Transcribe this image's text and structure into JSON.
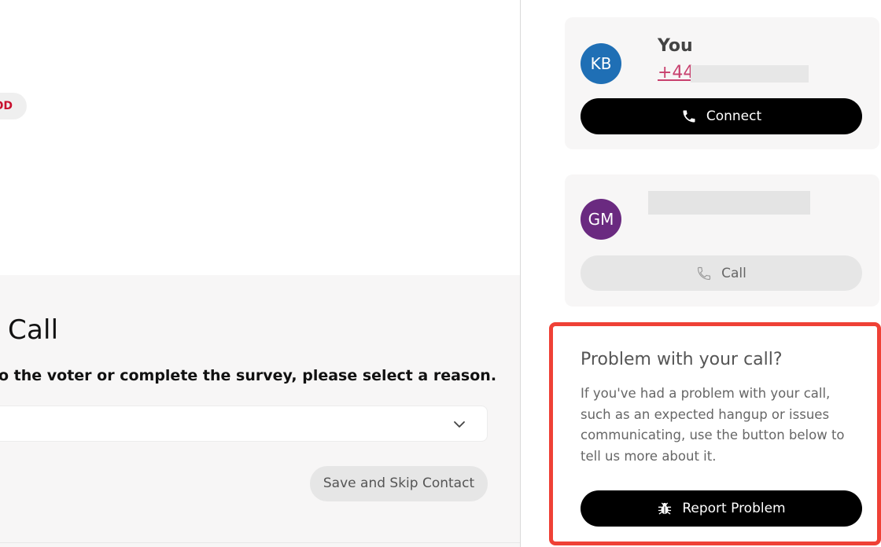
{
  "left": {
    "tag_text": "OD",
    "section_title": "Call",
    "instruction": "o the voter or complete the survey, please select a reason.",
    "select": {
      "value": ""
    },
    "skip_button": "Save and Skip Contact"
  },
  "contacts": [
    {
      "initials": "KB",
      "name": "You",
      "phone": "+44",
      "button": "Connect",
      "button_icon": "phone-icon",
      "avatar_color": "#1f6fb5"
    },
    {
      "initials": "GM",
      "name": "",
      "phone": "",
      "button": "Call",
      "button_icon": "phone-icon",
      "avatar_color": "#6a2a80"
    }
  ],
  "problem": {
    "title": "Problem with your call?",
    "body": "If you've had a problem with your call, such as an expected hangup or issues communicating, use the button below to tell us more about it.",
    "button": "Report Problem",
    "button_icon": "bug-icon"
  },
  "colors": {
    "accent": "#c8102e",
    "highlight": "#ef4136",
    "primary_button": "#000000"
  }
}
